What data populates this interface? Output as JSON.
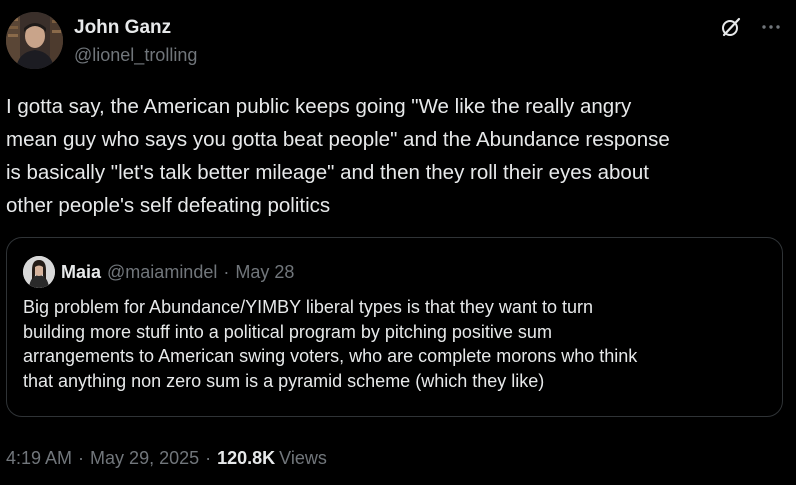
{
  "author": {
    "display_name": "John Ganz",
    "handle": "@lionel_trolling"
  },
  "tweet": {
    "text": "I gotta say, the American public keeps going \"We like the really angry\nmean guy who says you gotta beat people\" and the Abundance response\nis basically \"let's talk better mileage\" and then they roll their eyes about\nother people's self defeating politics"
  },
  "quote": {
    "display_name": "Maia",
    "handle": "@maiamindel",
    "separator": "·",
    "date": "May 28",
    "text": "Big problem for Abundance/YIMBY liberal types is that they want to turn\nbuilding more stuff into a political program by pitching positive sum\narrangements to American swing voters, who are complete morons who think\nthat anything non zero sum is a pyramid scheme (which they like)"
  },
  "meta": {
    "time": "4:19 AM",
    "separator": "·",
    "date": "May 29, 2025",
    "views_count": "120.8K",
    "views_label": "Views"
  },
  "icons": {
    "grok": "grok-icon",
    "more": "more-icon"
  },
  "colors": {
    "background": "#000000",
    "text_primary": "#e7e9ea",
    "text_secondary": "#71767b",
    "border": "#2f3336"
  }
}
